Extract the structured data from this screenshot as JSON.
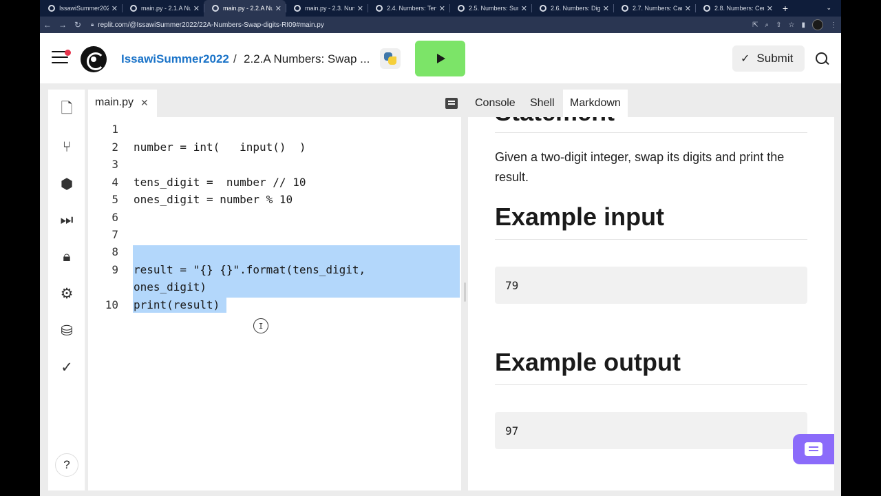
{
  "browser": {
    "tabs": [
      {
        "title": "IssawiSummer2022",
        "active": false
      },
      {
        "title": "main.py - 2.1.A Nu",
        "active": false
      },
      {
        "title": "main.py - 2.2.A Nu",
        "active": true
      },
      {
        "title": "main.py - 2.3. Num",
        "active": false
      },
      {
        "title": "2.4. Numbers: Ten",
        "active": false
      },
      {
        "title": "2.5. Numbers: Sun",
        "active": false
      },
      {
        "title": "2.6. Numbers: Digi",
        "active": false
      },
      {
        "title": "2.7. Numbers: Car",
        "active": false
      },
      {
        "title": "2.8. Numbers: Cen",
        "active": false
      }
    ],
    "new_tab_label": "+",
    "tab_close_glyph": "✕",
    "url": "replit.com/@IssawiSummer2022/22A-Numbers-Swap-digits-RI09#main.py"
  },
  "header": {
    "user": "IssawiSummer2022",
    "separator": "/",
    "repl_title": "2.2.A Numbers: Swap ...",
    "submit_label": "Submit",
    "accent_color": "#7ce468"
  },
  "sidebar": {
    "icons": [
      "files-icon",
      "git-icon",
      "packages-icon",
      "debugger-icon",
      "secrets-icon",
      "settings-icon",
      "database-icon",
      "unit-tests-icon"
    ],
    "help_label": "?"
  },
  "editor": {
    "file_tab": "main.py",
    "lines": [
      {
        "num": "1",
        "code": ""
      },
      {
        "num": "2",
        "code": "number = int(   input()  )"
      },
      {
        "num": "3",
        "code": ""
      },
      {
        "num": "4",
        "code": "tens_digit =  number // 10"
      },
      {
        "num": "5",
        "code": "ones_digit = number % 10"
      },
      {
        "num": "6",
        "code": ""
      },
      {
        "num": "7",
        "code": ""
      },
      {
        "num": "8",
        "code": ""
      },
      {
        "num": "9",
        "code": "result = \"{} {}\".format(tens_digit,"
      },
      {
        "num": "",
        "code": "ones_digit)"
      },
      {
        "num": "10",
        "code": "print(result)"
      }
    ],
    "cursor_glyph": "I"
  },
  "right_pane": {
    "tabs": [
      "Console",
      "Shell",
      "Markdown"
    ],
    "active_tab": "Markdown",
    "markdown": {
      "partial_heading": "Statement",
      "statement": "Given a two-digit integer, swap its digits and print the result.",
      "example_input_heading": "Example input",
      "example_input": "79",
      "example_output_heading": "Example output",
      "example_output": "97"
    }
  }
}
